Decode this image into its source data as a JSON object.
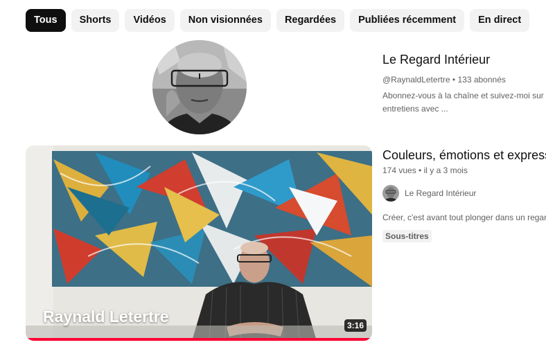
{
  "chips": [
    {
      "label": "Tous",
      "active": true
    },
    {
      "label": "Shorts"
    },
    {
      "label": "Vidéos"
    },
    {
      "label": "Non visionnées"
    },
    {
      "label": "Regardées"
    },
    {
      "label": "Publiées récemment"
    },
    {
      "label": "En direct"
    }
  ],
  "channel": {
    "name": "Le Regard Intérieur",
    "handle": "@RaynaldLetertre",
    "subscribers": "133 abonnés",
    "description_line1": "Abonnez-vous à la chaîne et suivez-moi sur l",
    "description_line2": "entretiens avec ..."
  },
  "video": {
    "title": "Couleurs, émotions et express",
    "views": "174 vues",
    "published": "il y a 3 mois",
    "channel_name": "Le Regard Intérieur",
    "description": "Créer, c'est avant tout plonger dans un regard",
    "badge": "Sous-titres",
    "duration": "3:16",
    "thumbnail_text": "Raynald Letertre",
    "progress_fraction": 1.0
  },
  "colors": {
    "accent_progress": "#ff0033",
    "chip_bg": "#f2f2f2",
    "chip_active_bg": "#0f0f0f"
  }
}
